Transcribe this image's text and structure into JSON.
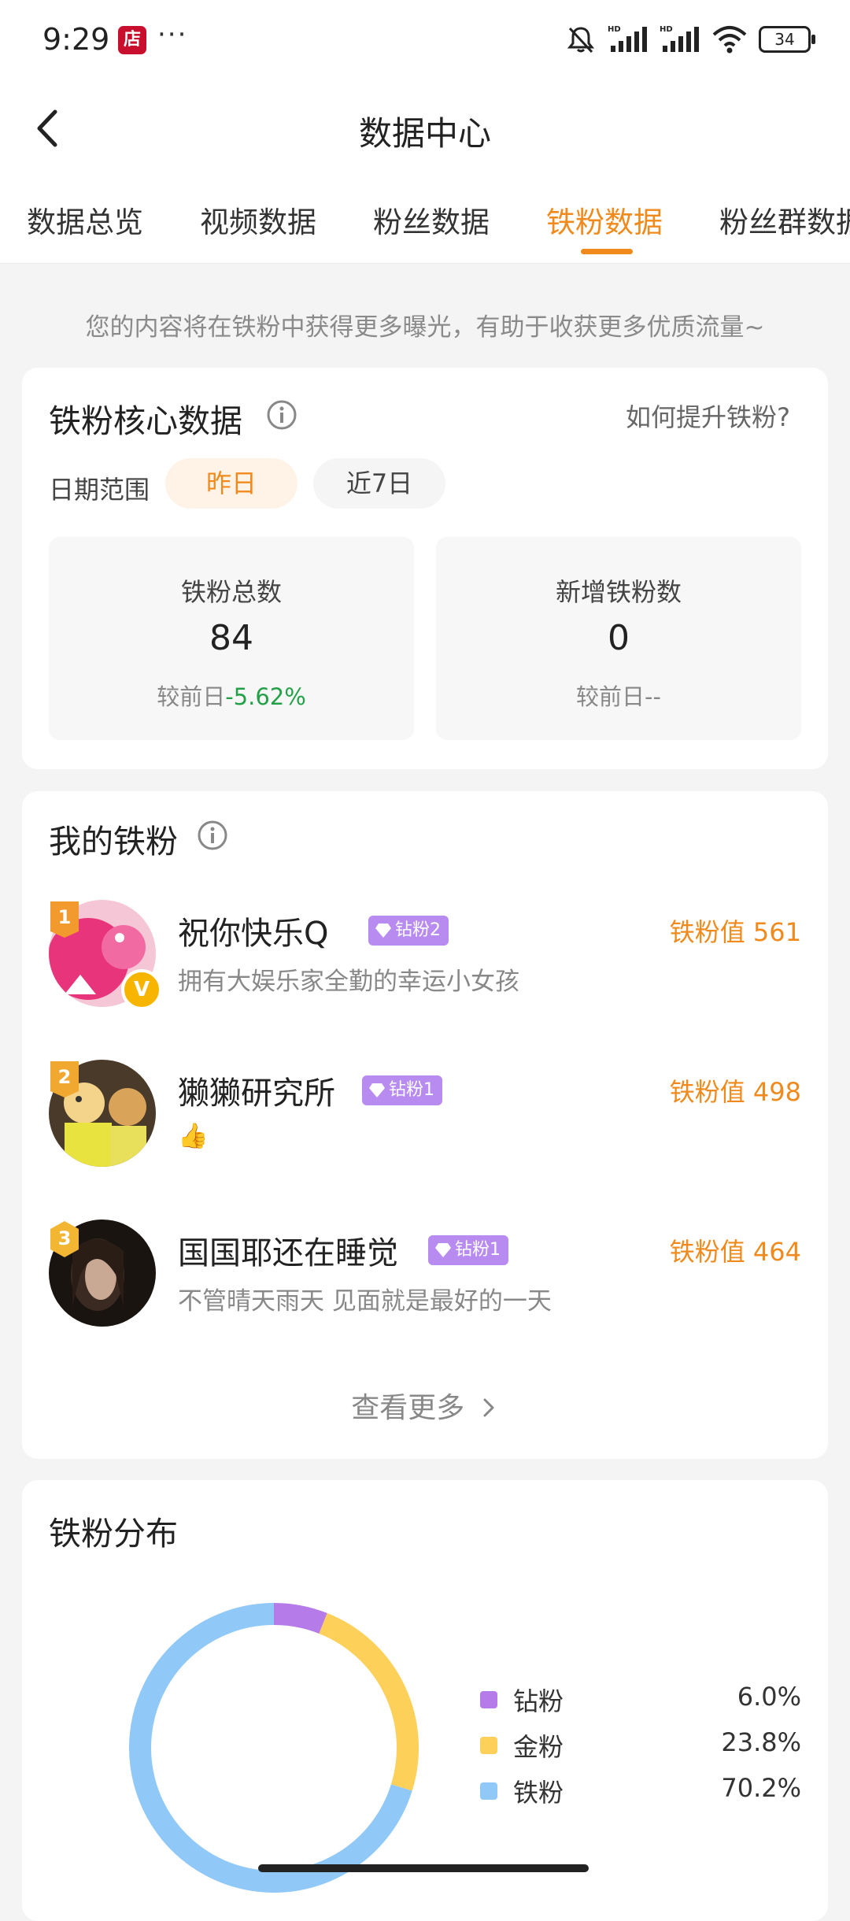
{
  "status": {
    "time": "9:29",
    "shop_badge": "店",
    "dots": "···",
    "battery": "34"
  },
  "nav": {
    "title": "数据中心"
  },
  "tabs": [
    {
      "label": "数据总览"
    },
    {
      "label": "视频数据"
    },
    {
      "label": "粉丝数据"
    },
    {
      "label": "铁粉数据"
    },
    {
      "label": "粉丝群数据"
    }
  ],
  "active_tab": "铁粉数据",
  "hint": "您的内容将在铁粉中获得更多曝光，有助于收获更多优质流量~",
  "core": {
    "title": "铁粉核心数据",
    "how_link": "如何提升铁粉?",
    "date_label": "日期范围",
    "ranges": [
      "昨日",
      "近7日"
    ],
    "stats": [
      {
        "label": "铁粉总数",
        "value": "84",
        "compare_prefix": "较前日",
        "compare_value": "-5.62%"
      },
      {
        "label": "新增铁粉数",
        "value": "0",
        "compare_prefix": "较前日",
        "compare_value": "--"
      }
    ]
  },
  "my_fans": {
    "title": "我的铁粉",
    "items": [
      {
        "rank": "1",
        "name": "祝你快乐Q",
        "badge": "钻粉2",
        "desc": "拥有大娱乐家全勤的幸运小女孩",
        "value": "铁粉值 561",
        "verified_mark": "V"
      },
      {
        "rank": "2",
        "name": "獭獭研究所",
        "badge": "钻粉1",
        "desc": "👍",
        "value": "铁粉值 498"
      },
      {
        "rank": "3",
        "name": "国国耶还在睡觉",
        "badge": "钻粉1",
        "desc": "不管晴天雨天 见面就是最好的一天",
        "value": "铁粉值 464"
      }
    ],
    "see_more": "查看更多"
  },
  "distribution": {
    "title": "铁粉分布",
    "legend": [
      {
        "name": "钻粉",
        "value": "6.0%",
        "color": "#b57be8"
      },
      {
        "name": "金粉",
        "value": "23.8%",
        "color": "#fdd05a"
      },
      {
        "name": "铁粉",
        "value": "70.2%",
        "color": "#90c9f7"
      }
    ]
  },
  "chart_data": {
    "type": "pie",
    "donut": true,
    "categories": [
      "钻粉",
      "金粉",
      "铁粉"
    ],
    "values": [
      6.0,
      23.8,
      70.2
    ],
    "colors": [
      "#b57be8",
      "#fdd05a",
      "#90c9f7"
    ],
    "title": "铁粉分布"
  }
}
